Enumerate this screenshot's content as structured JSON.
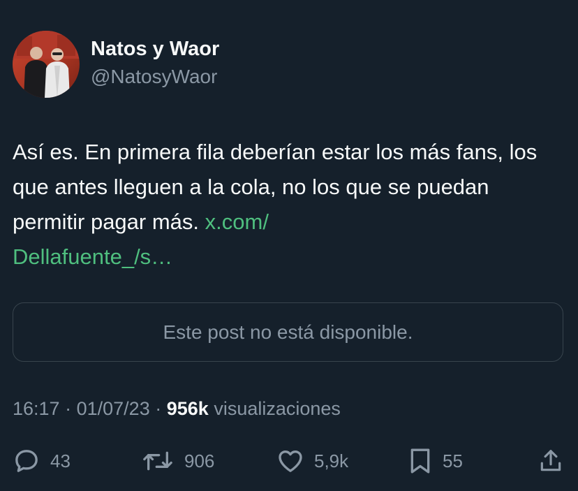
{
  "author": {
    "display_name": "Natos y Waor",
    "handle": "@NatosyWaor"
  },
  "tweet": {
    "text": "Así es. En primera fila deberían estar los más fans, los que antes lleguen a la cola, no los que se puedan permitir pagar más. ",
    "link_text": "x.com/\nDellafuente_/s…"
  },
  "quote": {
    "unavailable_text": "Este post no está disponible."
  },
  "meta": {
    "time": "16:17",
    "date": "01/07/23",
    "separator": "·",
    "views_count": "956k",
    "views_label": "visualizaciones"
  },
  "actions": {
    "replies": "43",
    "reposts": "906",
    "likes": "5,9k",
    "bookmarks": "55"
  },
  "colors": {
    "background": "#15202b",
    "primary_text": "#f7f9f9",
    "secondary_text": "#8b98a5",
    "link": "#4fbf7f",
    "border": "#38444d"
  },
  "icons": [
    "reply-icon",
    "repost-icon",
    "like-icon",
    "bookmark-icon",
    "share-icon"
  ]
}
